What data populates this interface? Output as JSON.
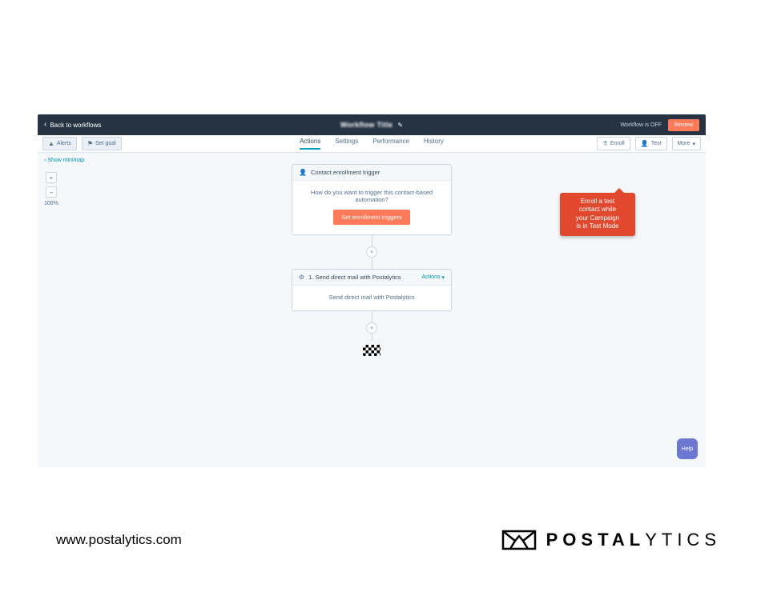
{
  "topbar": {
    "back_label": "Back to workflows",
    "workflow_title": "Workflow Title",
    "status_label": "Workflow is OFF",
    "review_label": "Review"
  },
  "toolbar": {
    "alerts_label": "Alerts",
    "setgoal_label": "Set goal",
    "enroll_label": "Enroll",
    "test_label": "Test",
    "more_label": "More"
  },
  "tabs": {
    "actions": "Actions",
    "settings": "Settings",
    "performance": "Performance",
    "history": "History"
  },
  "canvas": {
    "minimap_label": "Show minimap",
    "zoom_pct": "100%"
  },
  "trigger_card": {
    "title": "Contact enrollment trigger",
    "desc": "How do you want to trigger this contact-based automation?",
    "button": "Set enrollment triggers"
  },
  "action_card": {
    "title": "1. Send direct mail with Postalytics",
    "actions_label": "Actions",
    "desc": "Send direct mail with Postalytics"
  },
  "callout": {
    "line1": "Enroll a test",
    "line2": "contact while",
    "line3": "your Campaign",
    "line4": "is in Test Mode"
  },
  "help": {
    "label": "Help"
  },
  "footer": {
    "url": "www.postalytics.com",
    "brand_bold": "POSTAL",
    "brand_light": "YTICS"
  }
}
